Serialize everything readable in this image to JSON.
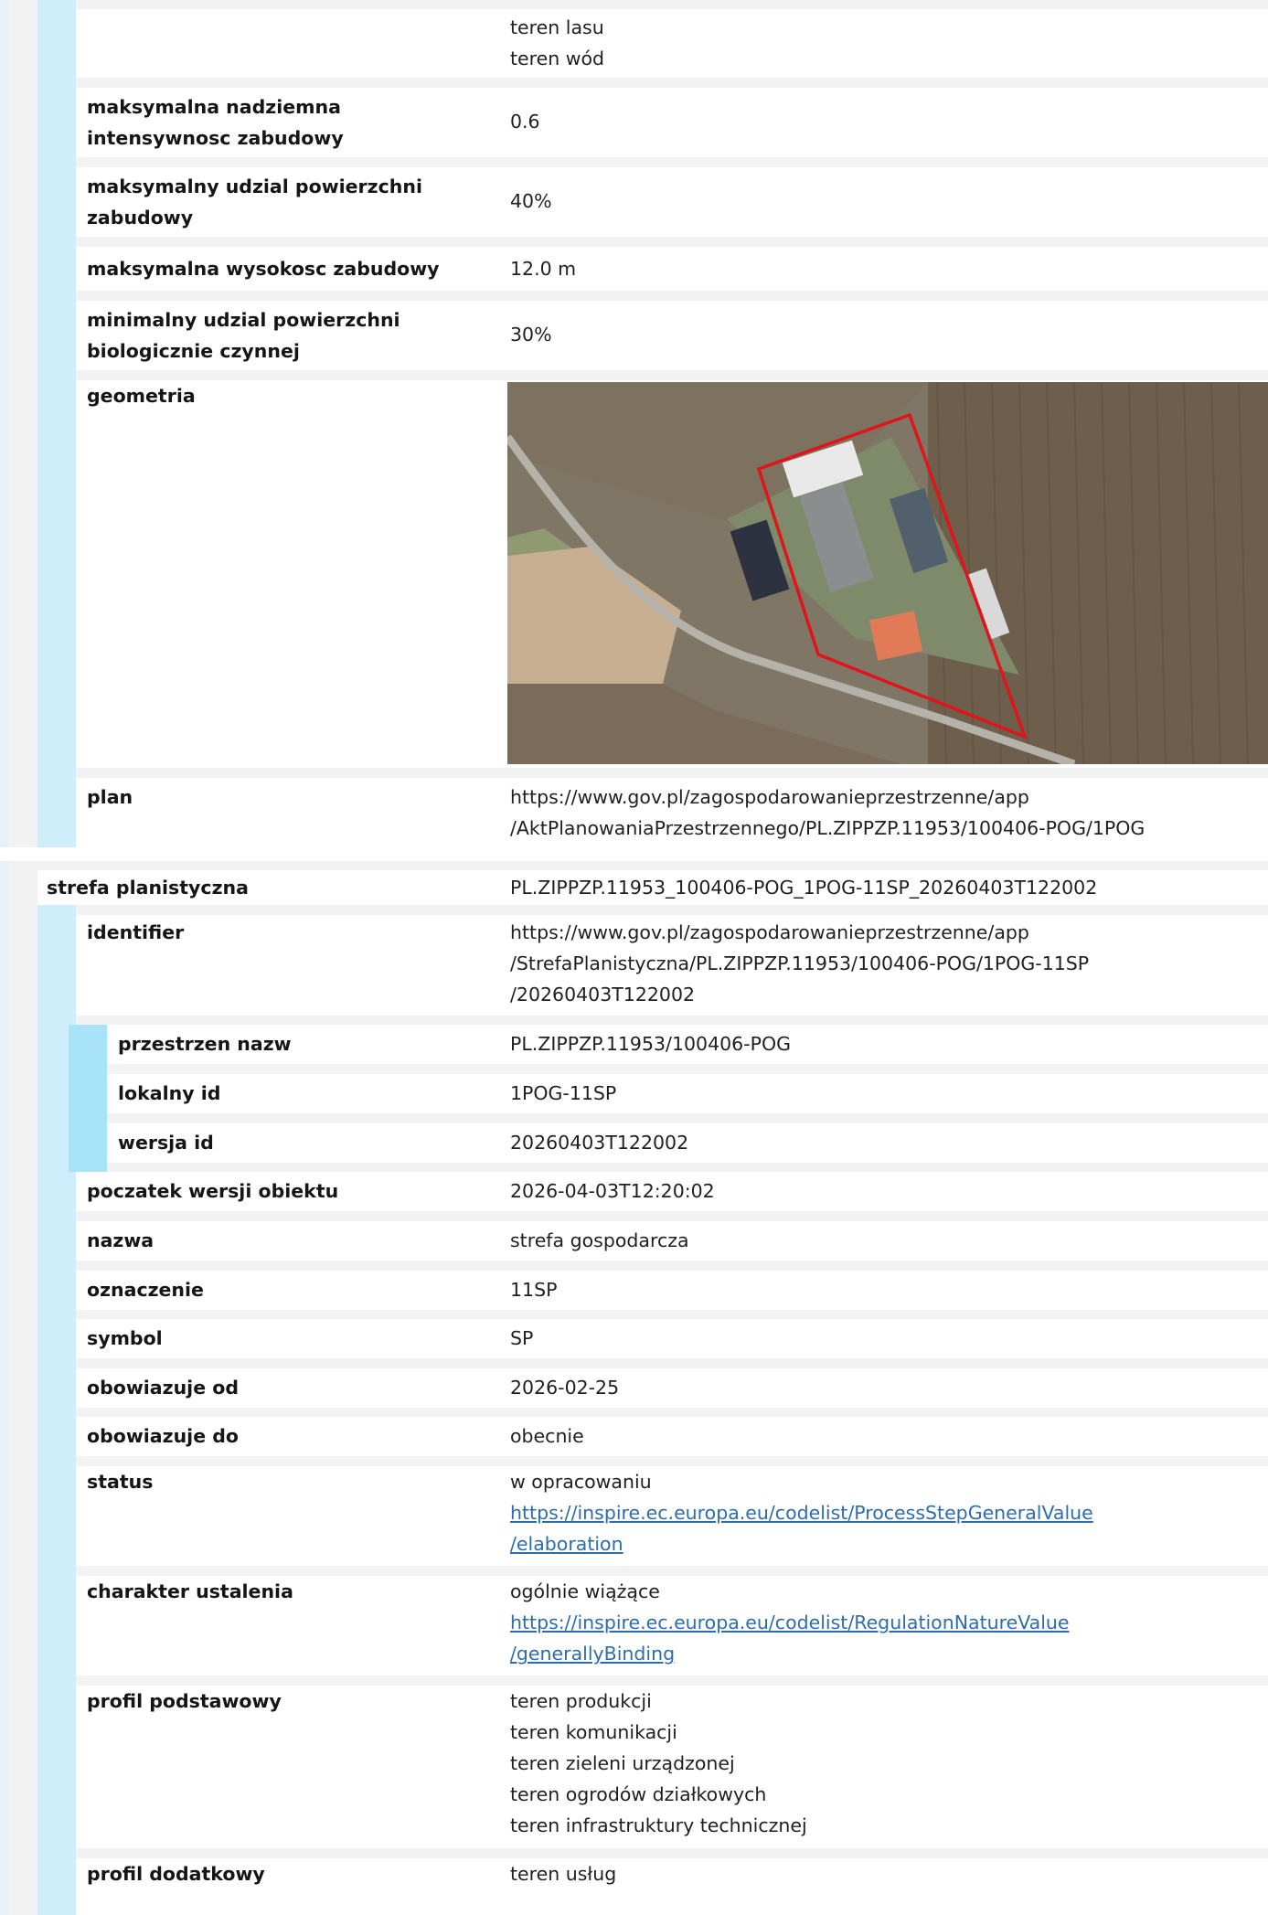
{
  "plan_section": {
    "forbidden_values": [
      "teren lasu",
      "teren wód"
    ],
    "max_above_ground_intensity": {
      "label": "maksymalna nadziemna intensywnosc zabudowy",
      "value": "0.6"
    },
    "max_built_area_share": {
      "label": "maksymalny udzial powierzchni zabudowy",
      "value": "40%"
    },
    "max_building_height": {
      "label": "maksymalna wysokosc zabudowy",
      "value": "12.0 m"
    },
    "min_biologically_active_share": {
      "label": "minimalny udzial powierzchni biologicznie czynnej",
      "value": "30%"
    },
    "geometry": {
      "label": "geometria"
    },
    "plan": {
      "label": "plan",
      "value_lines": [
        "https://www.gov.pl/zagospodarowanieprzestrzenne/app",
        "/AktPlanowaniaPrzestrzennego/PL.ZIPPZP.11953/100406-POG/1POG"
      ]
    }
  },
  "zone_section": {
    "header": {
      "label": "strefa planistyczna",
      "value": "PL.ZIPPZP.11953_100406-POG_1POG-11SP_20260403T122002"
    },
    "identifier": {
      "label": "identifier",
      "value_lines": [
        "https://www.gov.pl/zagospodarowanieprzestrzenne/app",
        "/StrefaPlanistyczna/PL.ZIPPZP.11953/100406-POG/1POG-11SP",
        "/20260403T122002"
      ],
      "namespace": {
        "label": "przestrzen nazw",
        "value": "PL.ZIPPZP.11953/100406-POG"
      },
      "local_id": {
        "label": "lokalny id",
        "value": "1POG-11SP"
      },
      "version_id": {
        "label": "wersja id",
        "value": "20260403T122002"
      }
    },
    "version_start": {
      "label": "poczatek wersji obiektu",
      "value": "2026-04-03T12:20:02"
    },
    "name": {
      "label": "nazwa",
      "value": "strefa gospodarcza"
    },
    "designation": {
      "label": "oznaczenie",
      "value": "11SP"
    },
    "symbol": {
      "label": "symbol",
      "value": "SP"
    },
    "valid_from": {
      "label": "obowiazuje od",
      "value": "2026-02-25"
    },
    "valid_to": {
      "label": "obowiazuje do",
      "value": "obecnie"
    },
    "status": {
      "label": "status",
      "value": "w opracowaniu",
      "link_lines": [
        "https://inspire.ec.europa.eu/codelist/ProcessStepGeneralValue",
        "/elaboration"
      ]
    },
    "regulation_nature": {
      "label": "charakter ustalenia",
      "value": "ogólnie wiążące",
      "link_lines": [
        "https://inspire.ec.europa.eu/codelist/RegulationNatureValue",
        "/generallyBinding"
      ]
    },
    "base_profile": {
      "label": "profil podstawowy",
      "values": [
        "teren produkcji",
        "teren komunikacji",
        "teren zieleni urządzonej",
        "teren ogrodów działkowych",
        "teren infrastruktury technicznej"
      ]
    },
    "additional_profile": {
      "label": "profil dodatkowy",
      "values": [
        "teren usług"
      ]
    }
  },
  "colors": {
    "accent_light": "#cfeefb",
    "accent_dark": "#a9e3f7",
    "link": "#2c6dad",
    "boundary": "#e0141b"
  }
}
